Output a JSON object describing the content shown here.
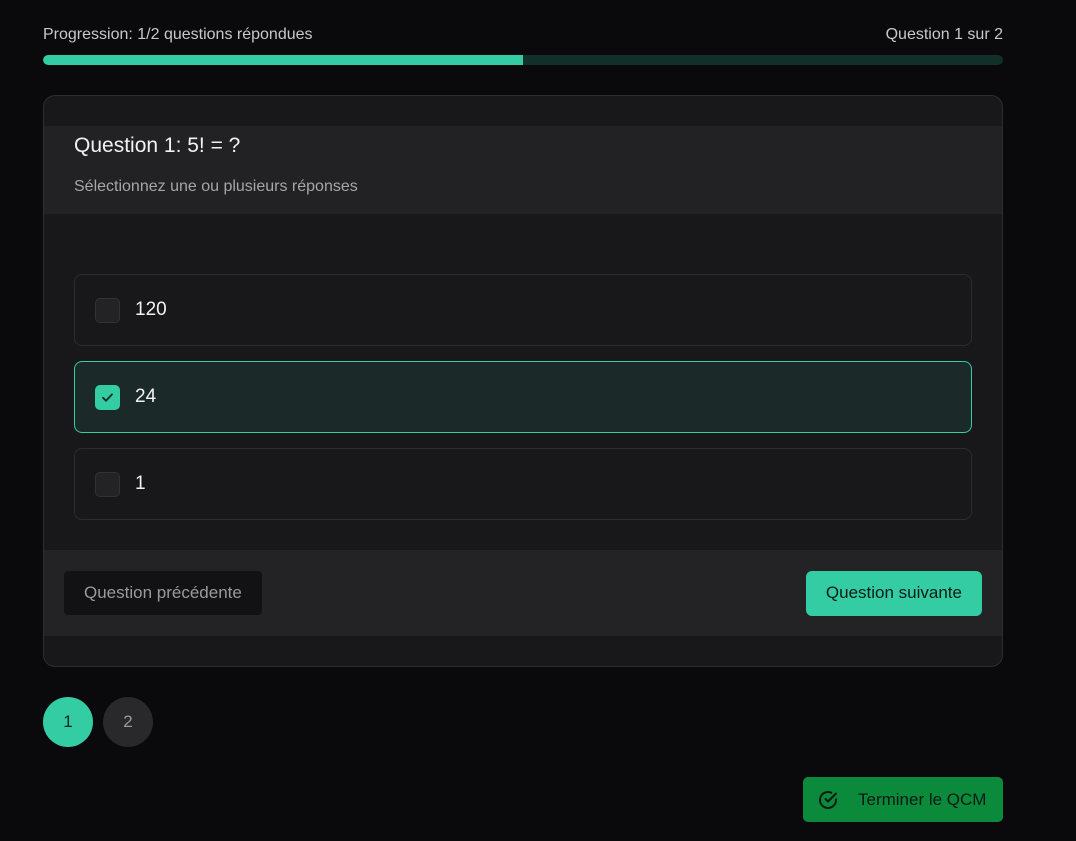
{
  "progress": {
    "label": "Progression: 1/2 questions répondues",
    "counter": "Question 1 sur 2",
    "fraction": 0.5
  },
  "question": {
    "title": "Question 1: 5! = ?",
    "hint": "Sélectionnez une ou plusieurs réponses",
    "options": [
      {
        "label": "120",
        "checked": false
      },
      {
        "label": "24",
        "checked": true
      },
      {
        "label": "1",
        "checked": false
      }
    ]
  },
  "nav": {
    "prev_label": "Question précédente",
    "next_label": "Question suivante"
  },
  "pager": {
    "pages": [
      "1",
      "2"
    ],
    "active": 0
  },
  "finish": {
    "label": "Terminer le QCM",
    "icon": "check-circle-icon"
  },
  "colors": {
    "accent": "#33cca3",
    "finish": "#0a8a3a",
    "background": "#0a0a0c"
  }
}
